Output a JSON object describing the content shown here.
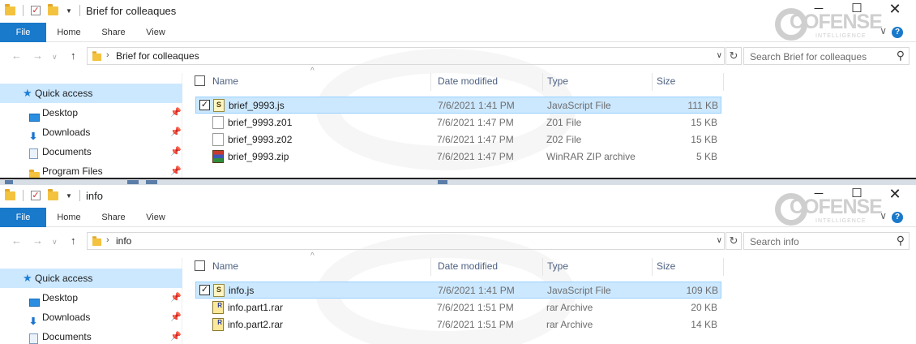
{
  "windows": [
    {
      "title": "Brief for colleaques",
      "ribbon_tabs": [
        "File",
        "Home",
        "Share",
        "View"
      ],
      "path": "Brief for colleaques",
      "search_placeholder": "Search Brief for colleaques",
      "nav": {
        "quick_access": "Quick access",
        "items": [
          {
            "label": "Desktop",
            "icon": "desktop-icon"
          },
          {
            "label": "Downloads",
            "icon": "downloads-icon"
          },
          {
            "label": "Documents",
            "icon": "documents-icon"
          },
          {
            "label": "Program Files",
            "icon": "folder-icon"
          }
        ]
      },
      "columns": [
        "Name",
        "Date modified",
        "Type",
        "Size"
      ],
      "files": [
        {
          "name": "brief_9993.js",
          "date": "7/6/2021 1:41 PM",
          "type": "JavaScript File",
          "size": "111 KB",
          "icon": "js-file-icon",
          "selected": true
        },
        {
          "name": "brief_9993.z01",
          "date": "7/6/2021 1:47 PM",
          "type": "Z01 File",
          "size": "15 KB",
          "icon": "generic-file-icon",
          "selected": false
        },
        {
          "name": "brief_9993.z02",
          "date": "7/6/2021 1:47 PM",
          "type": "Z02 File",
          "size": "15 KB",
          "icon": "generic-file-icon",
          "selected": false
        },
        {
          "name": "brief_9993.zip",
          "date": "7/6/2021 1:47 PM",
          "type": "WinRAR ZIP archive",
          "size": "5 KB",
          "icon": "winrar-zip-icon",
          "selected": false
        }
      ]
    },
    {
      "title": "info",
      "ribbon_tabs": [
        "File",
        "Home",
        "Share",
        "View"
      ],
      "path": "info",
      "search_placeholder": "Search info",
      "nav": {
        "quick_access": "Quick access",
        "items": [
          {
            "label": "Desktop",
            "icon": "desktop-icon"
          },
          {
            "label": "Downloads",
            "icon": "downloads-icon"
          },
          {
            "label": "Documents",
            "icon": "documents-icon"
          }
        ]
      },
      "columns": [
        "Name",
        "Date modified",
        "Type",
        "Size"
      ],
      "files": [
        {
          "name": "info.js",
          "date": "7/6/2021 1:41 PM",
          "type": "JavaScript File",
          "size": "109 KB",
          "icon": "js-file-icon",
          "selected": true
        },
        {
          "name": "info.part1.rar",
          "date": "7/6/2021 1:51 PM",
          "type": "rar Archive",
          "size": "20 KB",
          "icon": "rar-archive-icon",
          "selected": false
        },
        {
          "name": "info.part2.rar",
          "date": "7/6/2021 1:51 PM",
          "type": "rar Archive",
          "size": "14 KB",
          "icon": "rar-archive-icon",
          "selected": false
        }
      ]
    }
  ],
  "watermark": {
    "brand": "COFENSE",
    "sub": "INTELLIGENCE"
  },
  "colors": {
    "accent": "#1979ca",
    "selection": "#cce8ff",
    "selection_border": "#99d1ff",
    "header_text": "#4d6182"
  }
}
